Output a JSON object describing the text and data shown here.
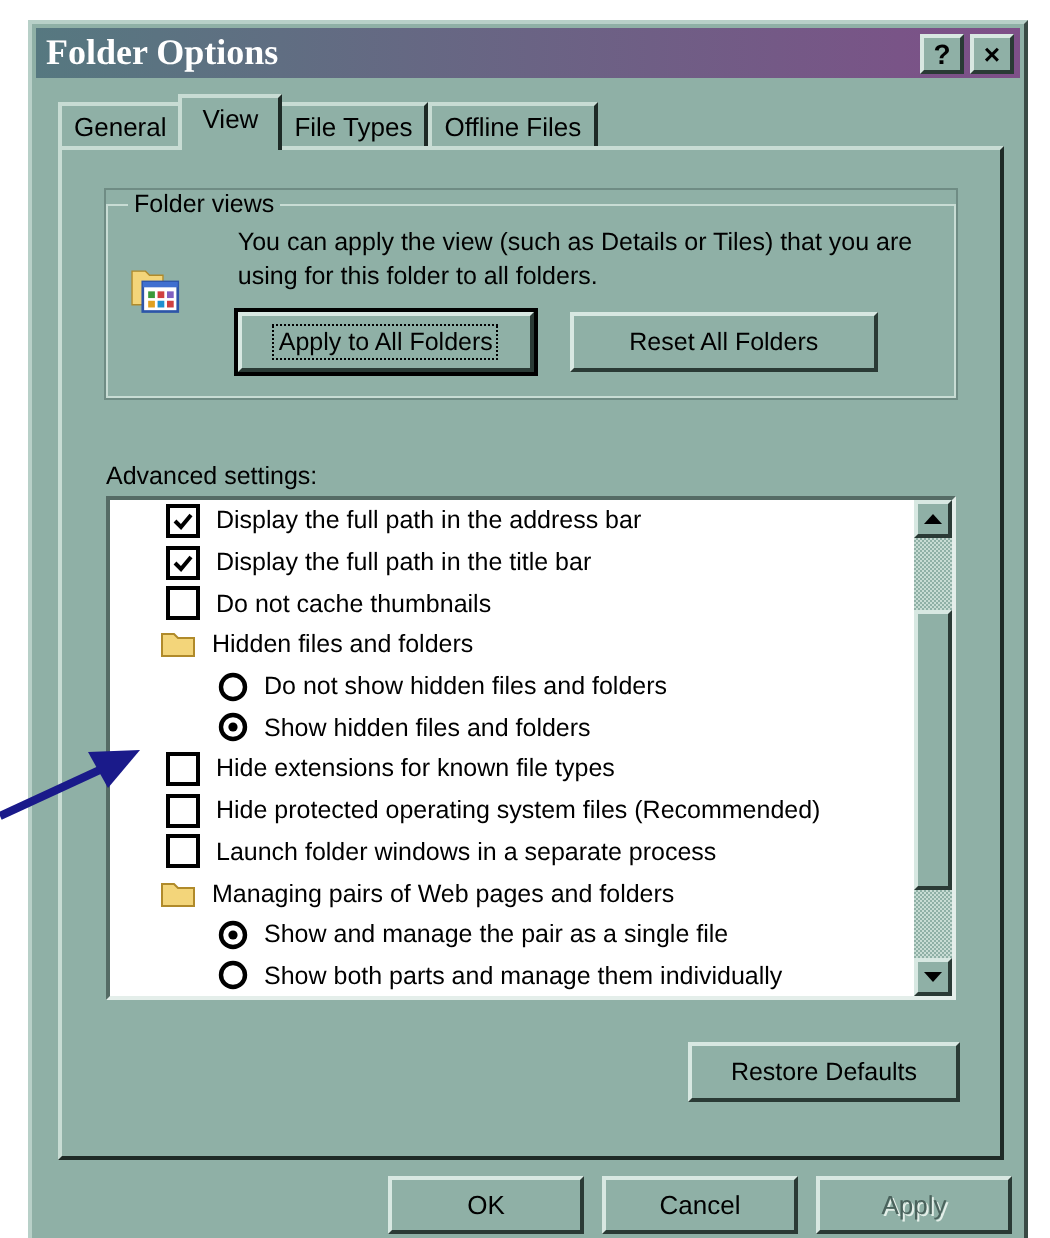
{
  "window": {
    "title": "Folder Options",
    "help_button": "?",
    "close_button": "×"
  },
  "tabs": [
    {
      "label": "General",
      "selected": false
    },
    {
      "label": "View",
      "selected": true
    },
    {
      "label": "File Types",
      "selected": false
    },
    {
      "label": "Offline Files",
      "selected": false
    }
  ],
  "folder_views": {
    "title": "Folder views",
    "description": "You can apply the view (such as Details or Tiles) that you are using for this folder to all folders.",
    "buttons": [
      {
        "label": "Apply to All Folders",
        "focused": true
      },
      {
        "label": "Reset All Folders",
        "focused": false
      }
    ]
  },
  "advanced_settings": {
    "label": "Advanced settings:",
    "items": [
      {
        "kind": "checkbox",
        "label": "Display the full path in the address bar",
        "checked": true
      },
      {
        "kind": "checkbox",
        "label": "Display the full path in the title bar",
        "checked": true
      },
      {
        "kind": "checkbox",
        "label": "Do not cache thumbnails",
        "checked": false
      },
      {
        "kind": "group",
        "label": "Hidden files and folders",
        "children": [
          {
            "kind": "radio",
            "label": "Do not show hidden files and folders",
            "selected": false
          },
          {
            "kind": "radio",
            "label": "Show hidden files and folders",
            "selected": true
          }
        ]
      },
      {
        "kind": "checkbox",
        "label": "Hide extensions for known file types",
        "checked": false
      },
      {
        "kind": "checkbox",
        "label": "Hide protected operating system files (Recommended)",
        "checked": false
      },
      {
        "kind": "checkbox",
        "label": "Launch folder windows in a separate process",
        "checked": false
      },
      {
        "kind": "group",
        "label": "Managing pairs of Web pages and folders",
        "children": [
          {
            "kind": "radio",
            "label": "Show and manage the pair as a single file",
            "selected": true
          },
          {
            "kind": "radio",
            "label": "Show both parts and manage them individually",
            "selected": false
          }
        ]
      }
    ],
    "restore_button": "Restore Defaults"
  },
  "dialog_buttons": [
    {
      "label": "OK",
      "disabled": false
    },
    {
      "label": "Cancel",
      "disabled": false
    },
    {
      "label": "Apply",
      "disabled": true
    }
  ]
}
